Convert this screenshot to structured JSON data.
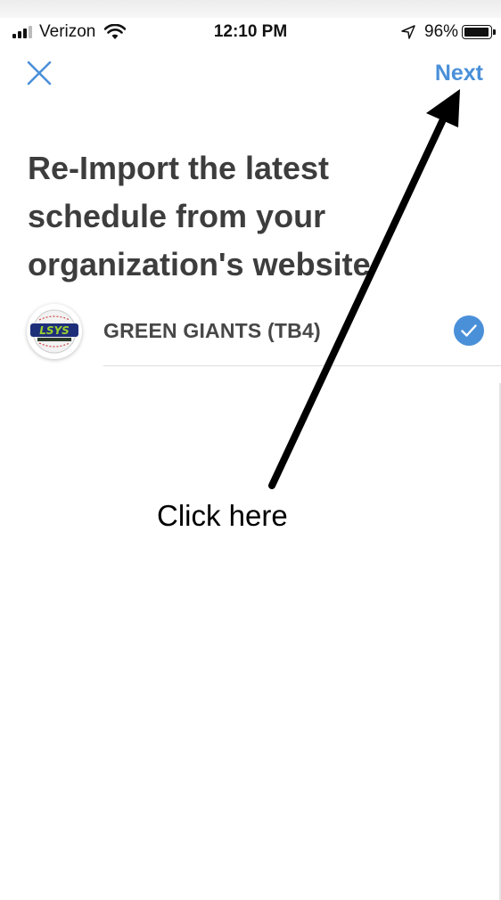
{
  "status_bar": {
    "carrier": "Verizon",
    "time": "12:10 PM",
    "battery_percent": "96%",
    "battery_level": 0.96,
    "icons": [
      "signal-icon",
      "wifi-icon",
      "location-icon",
      "battery-icon"
    ]
  },
  "nav": {
    "close_icon": "close-icon",
    "next_label": "Next"
  },
  "page": {
    "title": "Re-Import the latest schedule from your organization's website"
  },
  "teams": [
    {
      "name": "GREEN GIANTS (TB4)",
      "logo_text": "LSYS",
      "selected": true
    }
  ],
  "annotation": {
    "label": "Click here"
  },
  "colors": {
    "accent": "#4a90d9",
    "title": "#3d3d3d",
    "team_name": "#474747"
  }
}
